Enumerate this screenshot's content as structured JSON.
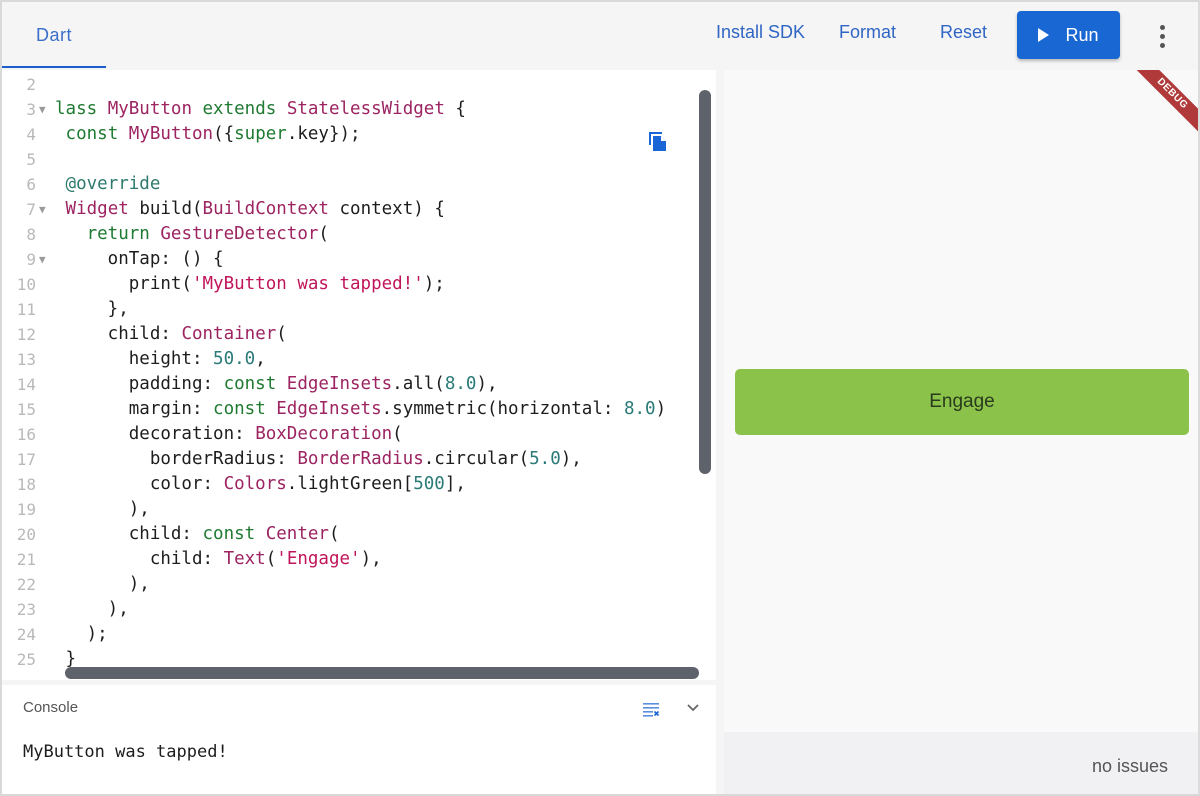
{
  "topbar": {
    "tab_label": "Dart",
    "install_sdk": "Install SDK",
    "format": "Format",
    "reset": "Reset",
    "run": "Run",
    "more_icon": "more-vert-icon"
  },
  "editor": {
    "lines": [
      {
        "n": "2",
        "fold": false,
        "tokens": []
      },
      {
        "n": "3",
        "fold": true,
        "tokens": [
          [
            "lass ",
            "k-green"
          ],
          [
            "MyButton ",
            "k-purple"
          ],
          [
            "extends ",
            "k-green"
          ],
          [
            "StatelessWidget ",
            "k-purple"
          ],
          [
            "{",
            ""
          ]
        ]
      },
      {
        "n": "4",
        "fold": false,
        "tokens": [
          [
            " ",
            ""
          ],
          [
            "const ",
            "k-green"
          ],
          [
            "MyButton",
            "k-purple"
          ],
          [
            "({",
            ""
          ],
          [
            "super",
            "k-green"
          ],
          [
            ".key});",
            ""
          ]
        ]
      },
      {
        "n": "5",
        "fold": false,
        "tokens": []
      },
      {
        "n": "6",
        "fold": false,
        "tokens": [
          [
            " ",
            ""
          ],
          [
            "@override",
            "k-anno"
          ]
        ]
      },
      {
        "n": "7",
        "fold": true,
        "tokens": [
          [
            " ",
            ""
          ],
          [
            "Widget ",
            "k-purple"
          ],
          [
            "build(",
            ""
          ],
          [
            "BuildContext ",
            "k-purple"
          ],
          [
            "context) {",
            ""
          ]
        ]
      },
      {
        "n": "8",
        "fold": false,
        "tokens": [
          [
            "   ",
            ""
          ],
          [
            "return ",
            "k-green"
          ],
          [
            "GestureDetector",
            "k-purple"
          ],
          [
            "(",
            ""
          ]
        ]
      },
      {
        "n": "9",
        "fold": true,
        "tokens": [
          [
            "     onTap: () {",
            ""
          ]
        ]
      },
      {
        "n": "10",
        "fold": false,
        "tokens": [
          [
            "       print(",
            ""
          ],
          [
            "'MyButton was tapped!'",
            "k-str"
          ],
          [
            ");",
            ""
          ]
        ]
      },
      {
        "n": "11",
        "fold": false,
        "tokens": [
          [
            "     },",
            ""
          ]
        ]
      },
      {
        "n": "12",
        "fold": false,
        "tokens": [
          [
            "     child: ",
            ""
          ],
          [
            "Container",
            "k-purple"
          ],
          [
            "(",
            ""
          ]
        ]
      },
      {
        "n": "13",
        "fold": false,
        "tokens": [
          [
            "       height: ",
            ""
          ],
          [
            "50.0",
            "k-teal"
          ],
          [
            ",",
            ""
          ]
        ]
      },
      {
        "n": "14",
        "fold": false,
        "tokens": [
          [
            "       padding: ",
            ""
          ],
          [
            "const ",
            "k-green"
          ],
          [
            "EdgeInsets",
            "k-purple"
          ],
          [
            ".all(",
            ""
          ],
          [
            "8.0",
            "k-teal"
          ],
          [
            "),",
            ""
          ]
        ]
      },
      {
        "n": "15",
        "fold": false,
        "tokens": [
          [
            "       margin: ",
            ""
          ],
          [
            "const ",
            "k-green"
          ],
          [
            "EdgeInsets",
            "k-purple"
          ],
          [
            ".symmetric(horizontal: ",
            ""
          ],
          [
            "8.0",
            "k-teal"
          ],
          [
            ")",
            ""
          ]
        ]
      },
      {
        "n": "16",
        "fold": false,
        "tokens": [
          [
            "       decoration: ",
            ""
          ],
          [
            "BoxDecoration",
            "k-purple"
          ],
          [
            "(",
            ""
          ]
        ]
      },
      {
        "n": "17",
        "fold": false,
        "tokens": [
          [
            "         borderRadius: ",
            ""
          ],
          [
            "BorderRadius",
            "k-purple"
          ],
          [
            ".circular(",
            ""
          ],
          [
            "5.0",
            "k-teal"
          ],
          [
            "),",
            ""
          ]
        ]
      },
      {
        "n": "18",
        "fold": false,
        "tokens": [
          [
            "         color: ",
            ""
          ],
          [
            "Colors",
            "k-purple"
          ],
          [
            ".lightGreen[",
            ""
          ],
          [
            "500",
            "k-teal"
          ],
          [
            "],",
            ""
          ]
        ]
      },
      {
        "n": "19",
        "fold": false,
        "tokens": [
          [
            "       ),",
            ""
          ]
        ]
      },
      {
        "n": "20",
        "fold": false,
        "tokens": [
          [
            "       child: ",
            ""
          ],
          [
            "const ",
            "k-green"
          ],
          [
            "Center",
            "k-purple"
          ],
          [
            "(",
            ""
          ]
        ]
      },
      {
        "n": "21",
        "fold": false,
        "tokens": [
          [
            "         child: ",
            ""
          ],
          [
            "Text",
            "k-purple"
          ],
          [
            "(",
            ""
          ],
          [
            "'Engage'",
            "k-str"
          ],
          [
            "),",
            ""
          ]
        ]
      },
      {
        "n": "22",
        "fold": false,
        "tokens": [
          [
            "       ),",
            ""
          ]
        ]
      },
      {
        "n": "23",
        "fold": false,
        "tokens": [
          [
            "     ),",
            ""
          ]
        ]
      },
      {
        "n": "24",
        "fold": false,
        "tokens": [
          [
            "   );",
            ""
          ]
        ]
      },
      {
        "n": "25",
        "fold": false,
        "tokens": [
          [
            " }",
            ""
          ]
        ]
      }
    ]
  },
  "console": {
    "title": "Console",
    "output": "MyButton was tapped!"
  },
  "preview": {
    "button_label": "Engage",
    "button_color": "#8bc34a",
    "debug_banner": "DEBUG"
  },
  "status": {
    "text": "no issues"
  },
  "colors": {
    "accent": "#1967d2",
    "debug_red": "#b03a3a"
  }
}
